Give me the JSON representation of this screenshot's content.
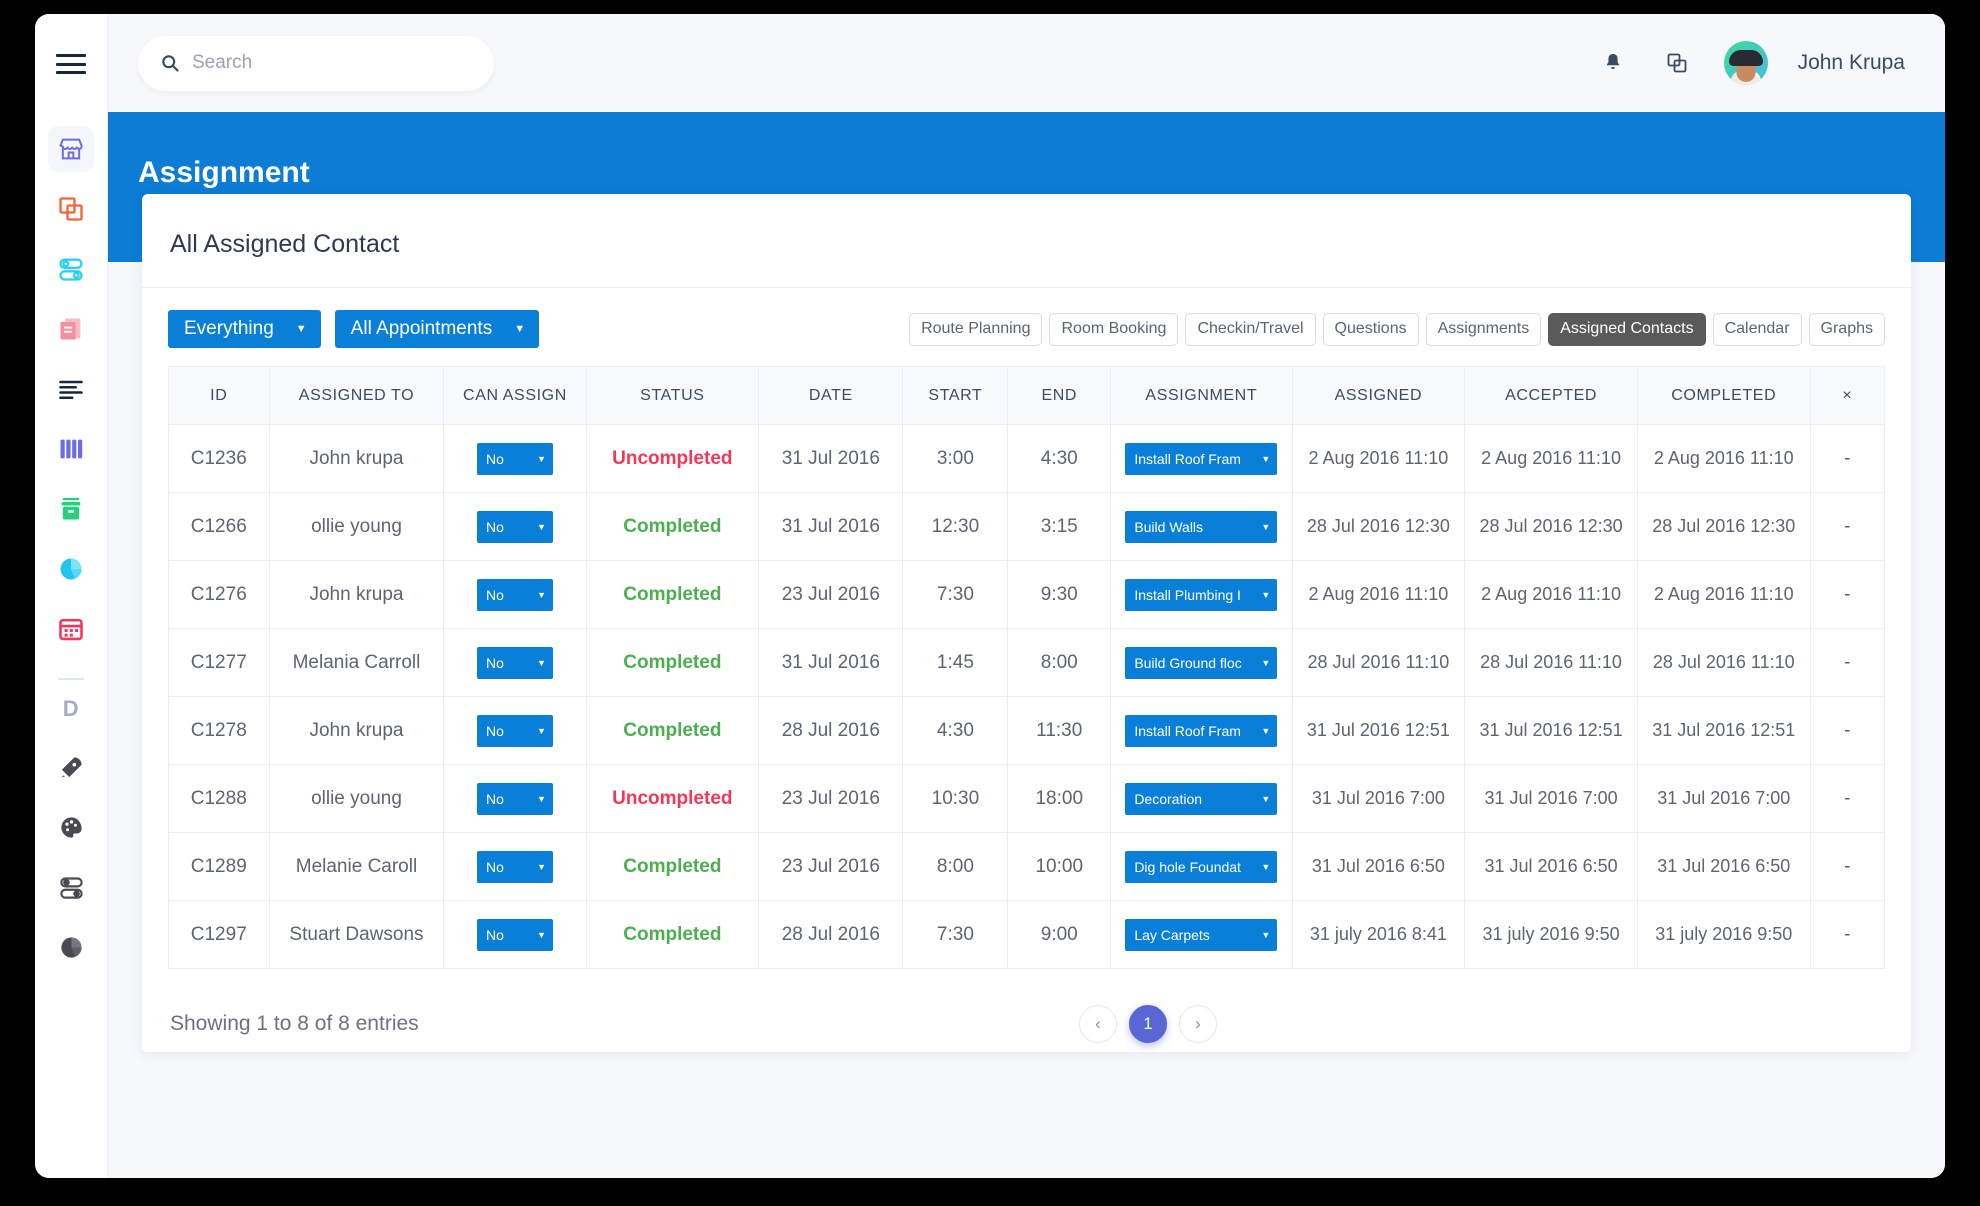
{
  "topbar": {
    "search_placeholder": "Search",
    "search_value": "",
    "notifications_icon": "bell-icon",
    "windows_icon": "copy-window-icon",
    "user_name": "John Krupa"
  },
  "sidebar": {
    "menu_icon": "hamburger-icon",
    "letter_badge": "D",
    "items": [
      {
        "name": "store-icon",
        "color": "#6c6ce5"
      },
      {
        "name": "copy-icon",
        "color": "#f4633a"
      },
      {
        "name": "toggles-icon",
        "color": "#2ad2f0"
      },
      {
        "name": "documents-icon",
        "color": "#f2a0ad"
      },
      {
        "name": "list-align-icon",
        "color": "#19253f"
      },
      {
        "name": "columns-icon",
        "color": "#6c6ce5"
      },
      {
        "name": "archive-icon",
        "color": "#26d07c"
      },
      {
        "name": "pie-chart-icon",
        "color": "#22c4f0"
      },
      {
        "name": "calendar-icon",
        "color": "#f2385a"
      }
    ],
    "items_bottom": [
      {
        "name": "rocket-icon",
        "color": "#4a4a55"
      },
      {
        "name": "palette-icon",
        "color": "#4a4a55"
      },
      {
        "name": "toggles-grey-icon",
        "color": "#4a4a55"
      },
      {
        "name": "pie-grey-icon",
        "color": "#4a4a55"
      }
    ]
  },
  "header": {
    "page_title": "Assignment",
    "band_color": "#0c7cd5"
  },
  "card": {
    "title": "All Assigned Contact",
    "filters": [
      {
        "label": "Everything"
      },
      {
        "label": "All Appointments"
      }
    ],
    "tabs": [
      {
        "label": "Route Planning",
        "active": false
      },
      {
        "label": "Room Booking",
        "active": false
      },
      {
        "label": "Checkin/Travel",
        "active": false
      },
      {
        "label": "Questions",
        "active": false
      },
      {
        "label": "Assignments",
        "active": false
      },
      {
        "label": "Assigned Contacts",
        "active": true
      },
      {
        "label": "Calendar",
        "active": false
      },
      {
        "label": "Graphs",
        "active": false
      }
    ],
    "columns": [
      "ID",
      "ASSIGNED TO",
      "CAN ASSIGN",
      "STATUS",
      "DATE",
      "START",
      "END",
      "ASSIGNMENT",
      "ASSIGNED",
      "ACCEPTED",
      "COMPLETED",
      "×"
    ],
    "rows": [
      {
        "id": "C1236",
        "assigned_to": "John krupa",
        "can_assign": "No",
        "status": "Uncompleted",
        "status_state": "undone",
        "date": "31 Jul 2016",
        "start": "3:00",
        "end": "4:30",
        "assignment": "Install Roof Fram",
        "assigned": "2 Aug 2016 11:10",
        "accepted": "2 Aug 2016 11:10",
        "completed": "2 Aug 2016 11:10",
        "x": "-"
      },
      {
        "id": "C1266",
        "assigned_to": "ollie young",
        "can_assign": "No",
        "status": "Completed",
        "status_state": "done",
        "date": "31 Jul 2016",
        "start": "12:30",
        "end": "3:15",
        "assignment": "Build Walls",
        "assigned": "28 Jul 2016 12:30",
        "accepted": "28 Jul 2016 12:30",
        "completed": "28 Jul 2016 12:30",
        "x": "-"
      },
      {
        "id": "C1276",
        "assigned_to": "John krupa",
        "can_assign": "No",
        "status": "Completed",
        "status_state": "done",
        "date": "23 Jul 2016",
        "start": "7:30",
        "end": "9:30",
        "assignment": "Install Plumbing I",
        "assigned": "2 Aug 2016 11:10",
        "accepted": "2 Aug 2016 11:10",
        "completed": "2 Aug 2016 11:10",
        "x": "-"
      },
      {
        "id": "C1277",
        "assigned_to": "Melania Carroll",
        "can_assign": "No",
        "status": "Completed",
        "status_state": "done",
        "date": "31 Jul 2016",
        "start": "1:45",
        "end": "8:00",
        "assignment": "Build Ground floc",
        "assigned": "28 Jul 2016 11:10",
        "accepted": "28 Jul 2016 11:10",
        "completed": "28 Jul 2016 11:10",
        "x": "-"
      },
      {
        "id": "C1278",
        "assigned_to": "John krupa",
        "can_assign": "No",
        "status": "Completed",
        "status_state": "done",
        "date": "28 Jul 2016",
        "start": "4:30",
        "end": "11:30",
        "assignment": "Install Roof Fram",
        "assigned": "31 Jul 2016 12:51",
        "accepted": "31 Jul 2016 12:51",
        "completed": "31 Jul 2016 12:51",
        "x": "-"
      },
      {
        "id": "C1288",
        "assigned_to": "ollie young",
        "can_assign": "No",
        "status": "Uncompleted",
        "status_state": "undone",
        "date": "23 Jul 2016",
        "start": "10:30",
        "end": "18:00",
        "assignment": "Decoration",
        "assigned": "31 Jul 2016 7:00",
        "accepted": "31 Jul 2016 7:00",
        "completed": "31 Jul 2016 7:00",
        "x": "-"
      },
      {
        "id": "C1289",
        "assigned_to": "Melanie Caroll",
        "can_assign": "No",
        "status": "Completed",
        "status_state": "done",
        "date": "23 Jul 2016",
        "start": "8:00",
        "end": "10:00",
        "assignment": "Dig hole Foundat",
        "assigned": "31 Jul 2016 6:50",
        "accepted": "31 Jul 2016 6:50",
        "completed": "31 Jul 2016 6:50",
        "x": "-"
      },
      {
        "id": "C1297",
        "assigned_to": "Stuart Dawsons",
        "can_assign": "No",
        "status": "Completed",
        "status_state": "done",
        "date": "28 Jul 2016",
        "start": "7:30",
        "end": "9:00",
        "assignment": "Lay Carpets",
        "assigned": "31 july 2016 8:41",
        "accepted": "31 july 2016 9:50",
        "completed": "31 july 2016 9:50",
        "x": "-"
      }
    ],
    "footer": {
      "entries_text": "Showing 1 to 8 of 8 entries",
      "prev_label": "‹",
      "current_page": "1",
      "next_label": "›"
    }
  },
  "colors": {
    "brand_blue": "#0a7fd8",
    "band_blue": "#0c7cd5",
    "status_done": "#4caf50",
    "status_undone": "#f2385a",
    "tab_active_bg": "#5a5a5a",
    "pager_active": "#5a66d6"
  }
}
